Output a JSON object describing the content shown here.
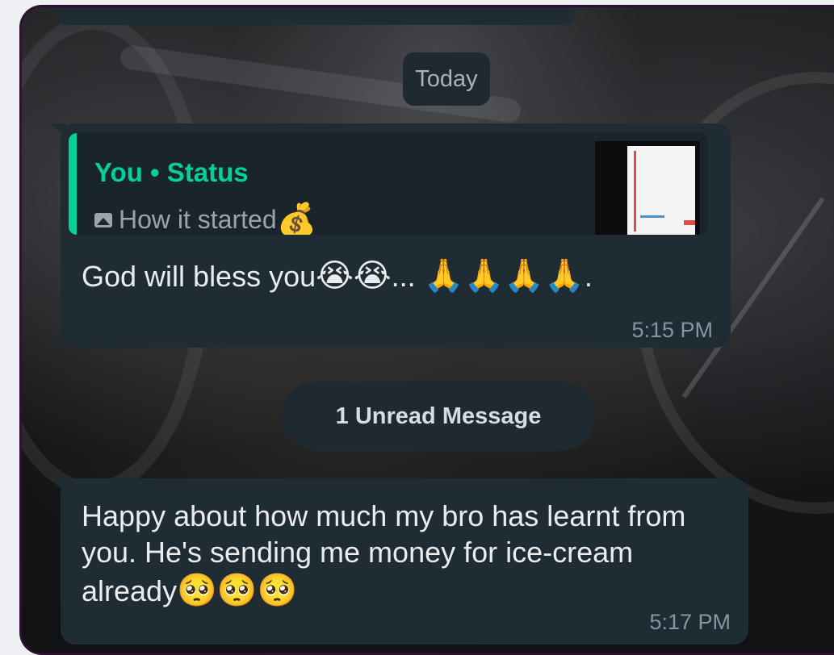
{
  "date_divider": "Today",
  "message1": {
    "reply": {
      "author": "You • Status",
      "snippet": "How it started",
      "snippet_emoji": "💰"
    },
    "text": "God will bless you",
    "emoji_a": "😭😭",
    "ellipsis": "...",
    "emoji_b": "🙏🙏🙏🙏",
    "suffix": ".",
    "time": "5:15 PM"
  },
  "unread_banner": "1 Unread Message",
  "message2": {
    "text": "Happy about how much my bro has learnt from you.  He's sending me money for ice-cream already",
    "emoji": "🥺🥺🥺",
    "time": "5:17 PM"
  },
  "colors": {
    "accent": "#06cf9c",
    "bubble": "#1f2c33",
    "text": "#e9edef",
    "meta": "#8696a0"
  }
}
